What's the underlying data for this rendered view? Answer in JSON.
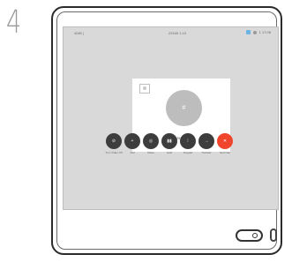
{
  "step": {
    "number": "4"
  },
  "status_bar": {
    "left": "4080 |",
    "center": "29165 1:15",
    "right_time": "1 17:08",
    "icons": [
      "camera-icon",
      "person-icon"
    ]
  },
  "call": {
    "name": "29165",
    "avatar_glyph": "#"
  },
  "controls": [
    {
      "name": "audio-mute-button",
      "glyph": "⊘",
      "label": "Turn Video Off",
      "variant": "normal"
    },
    {
      "name": "add-participant-button",
      "glyph": "+",
      "label": "Add",
      "variant": "normal"
    },
    {
      "name": "share-button",
      "glyph": "◎",
      "label": "Share",
      "variant": "normal"
    },
    {
      "name": "hold-button",
      "glyph": "▮▮",
      "label": "Hold",
      "variant": "normal"
    },
    {
      "name": "keypad-button",
      "glyph": "⁞",
      "label": "Keypad",
      "variant": "normal"
    },
    {
      "name": "transfer-button",
      "glyph": "→",
      "label": "Transfer",
      "variant": "normal"
    },
    {
      "name": "end-call-button",
      "glyph": "✕",
      "label": "End Call",
      "variant": "end"
    }
  ],
  "colors": {
    "end_call": "#f0442c",
    "control": "#3d3d3d",
    "screen": "#d9d9d9"
  }
}
